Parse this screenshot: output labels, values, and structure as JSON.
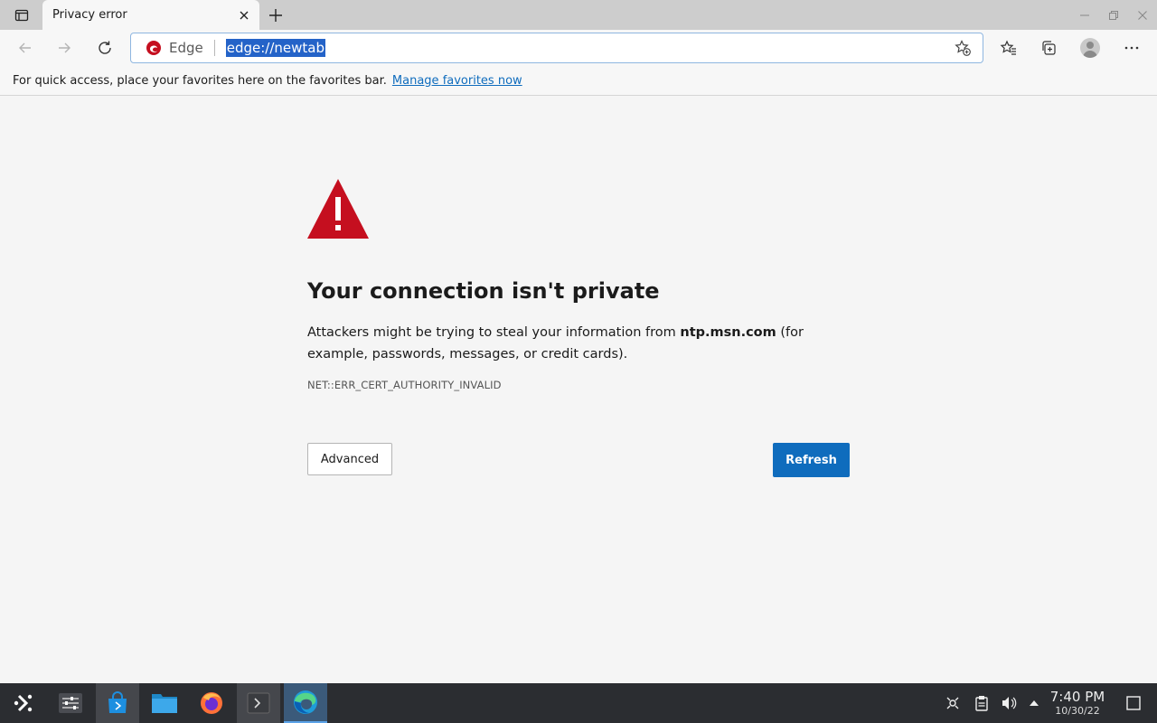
{
  "browser": {
    "tab": {
      "title": "Privacy error"
    },
    "omnibox": {
      "site_label": "Edge",
      "url": "edge://newtab"
    }
  },
  "favorites_bar": {
    "message": "For quick access, place your favorites here on the favorites bar.",
    "link": "Manage favorites now"
  },
  "error_page": {
    "heading": "Your connection isn't private",
    "desc_prefix": "Attackers might be trying to steal your information from ",
    "domain": "ntp.msn.com",
    "desc_suffix": " (for example, passwords, messages, or credit cards).",
    "error_code": "NET::ERR_CERT_AUTHORITY_INVALID",
    "advanced_label": "Advanced",
    "refresh_label": "Refresh",
    "accent_color": "#0f6cbd",
    "warning_color": "#c50f1f"
  },
  "taskbar": {
    "items": [
      "app-launcher-icon",
      "system-settings-icon",
      "discover-store-icon",
      "file-manager-icon",
      "firefox-icon",
      "terminal-icon",
      "edge-icon"
    ],
    "clock": {
      "time": "7:40 PM",
      "date": "10/30/22"
    }
  }
}
